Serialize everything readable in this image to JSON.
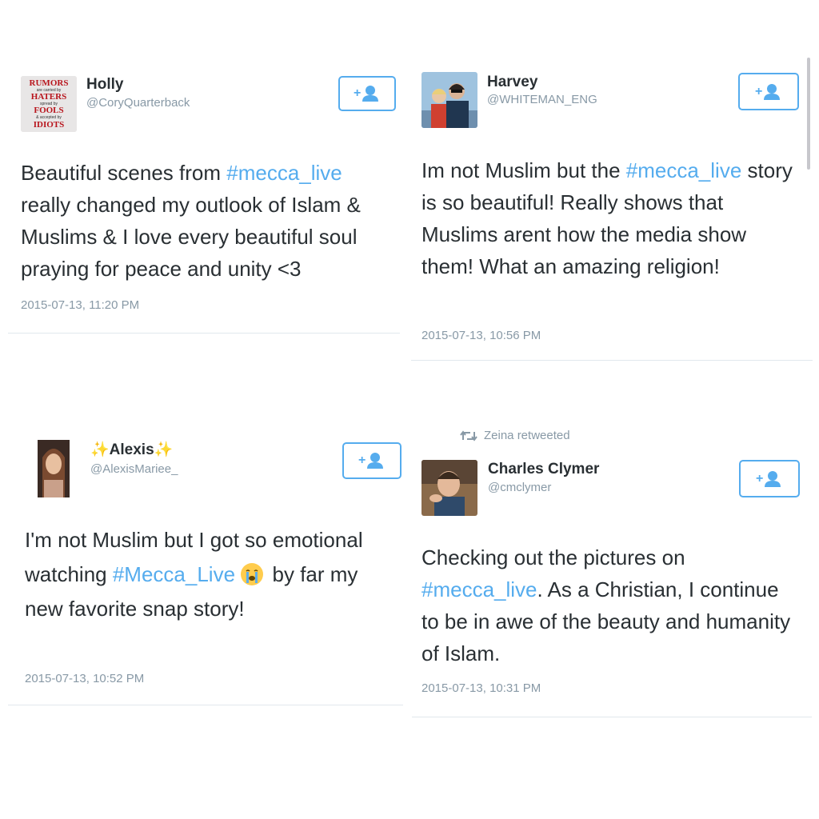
{
  "colors": {
    "accent": "#55acee",
    "text": "#292f33",
    "muted": "#8899a6",
    "divider": "#e1e8ed"
  },
  "tweets": [
    {
      "name": "Holly",
      "handle": "@CoryQuarterback",
      "avatar_lines": [
        "RUMORS",
        "are carried by",
        "HATERS",
        "spread by",
        "FOOLS",
        "& accepted by",
        "IDIOTS"
      ],
      "text_parts": [
        {
          "t": "Beautiful scenes from "
        },
        {
          "t": "#mecca_live",
          "tag": true
        },
        {
          "t": " really changed my outlook of Islam & Muslims & I love every beautiful soul praying for peace and unity <3"
        }
      ],
      "time": "2015-07-13, 11:20 PM"
    },
    {
      "name": "Harvey",
      "handle": "@WHITEMAN_ENG",
      "text_parts": [
        {
          "t": "Im not Muslim but the "
        },
        {
          "t": "#mecca_live",
          "tag": true
        },
        {
          "t": " story is so beautiful! Really shows that Muslims arent how the media show them! What an amazing religion!"
        }
      ],
      "time": "2015-07-13, 10:56 PM"
    },
    {
      "name": "✨Alexis✨",
      "handle": "@AlexisMariee_",
      "text_parts": [
        {
          "t": "I'm not Muslim but I got so emotional watching "
        },
        {
          "t": "#Mecca_Live",
          "tag": true
        },
        {
          "t": " "
        },
        {
          "t": "😭",
          "emoji": true
        },
        {
          "t": " by far my new favorite snap story!"
        }
      ],
      "time": "2015-07-13, 10:52 PM"
    },
    {
      "retweet_label": "Zeina retweeted",
      "name": "Charles Clymer",
      "handle": "@cmclymer",
      "text_parts": [
        {
          "t": "Checking out the pictures on "
        },
        {
          "t": "#mecca_live",
          "tag": true
        },
        {
          "t": ". As a Christian, I continue to be in awe of the beauty and humanity of Islam."
        }
      ],
      "time": "2015-07-13, 10:31 PM"
    }
  ],
  "icons": {
    "follow": "follow-user-icon",
    "retweet": "retweet-icon"
  }
}
